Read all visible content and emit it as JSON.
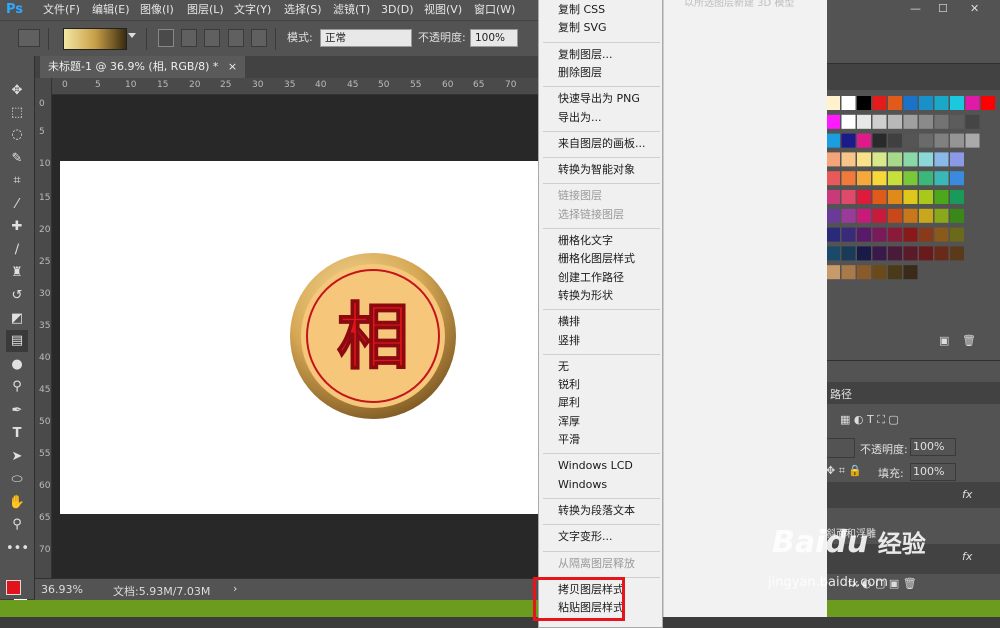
{
  "app": {
    "logo": "Ps"
  },
  "menubar": {
    "items": [
      "文件(F)",
      "编辑(E)",
      "图像(I)",
      "图层(L)",
      "文字(Y)",
      "选择(S)",
      "滤镜(T)",
      "3D(D)",
      "视图(V)",
      "窗口(W)"
    ]
  },
  "options": {
    "mode_label": "模式:",
    "mode_value": "正常",
    "opacity_label": "不透明度:",
    "opacity_value": "100%"
  },
  "document": {
    "tab_title": "未标题-1 @ 36.9% (相, RGB/8) *",
    "close": "×",
    "chess_char": "相"
  },
  "ruler": {
    "h_ticks": [
      "0",
      "5",
      "10",
      "15",
      "20",
      "25",
      "30",
      "35",
      "40",
      "45",
      "50",
      "55",
      "60",
      "65",
      "70"
    ],
    "v_ticks": [
      "0",
      "5",
      "10",
      "15",
      "20",
      "25",
      "30",
      "35",
      "40",
      "45",
      "50",
      "55",
      "60",
      "65",
      "70"
    ]
  },
  "status": {
    "zoom": "36.93%",
    "doc_size": "文档:5.93M/7.03M",
    "arrow": "›"
  },
  "context_menu": {
    "items": [
      {
        "label": "复制 CSS",
        "disabled": false
      },
      {
        "label": "复制 SVG",
        "disabled": false
      },
      {
        "sep": true
      },
      {
        "label": "复制图层...",
        "disabled": false
      },
      {
        "label": "删除图层",
        "disabled": false
      },
      {
        "sep": true
      },
      {
        "label": "快速导出为 PNG",
        "disabled": false
      },
      {
        "label": "导出为...",
        "disabled": false
      },
      {
        "sep": true
      },
      {
        "label": "来自图层的画板...",
        "disabled": false
      },
      {
        "sep": true
      },
      {
        "label": "转换为智能对象",
        "disabled": false
      },
      {
        "sep": true
      },
      {
        "label": "链接图层",
        "disabled": true
      },
      {
        "label": "选择链接图层",
        "disabled": true
      },
      {
        "sep": true
      },
      {
        "label": "栅格化文字",
        "disabled": false
      },
      {
        "label": "栅格化图层样式",
        "disabled": false
      },
      {
        "label": "创建工作路径",
        "disabled": false
      },
      {
        "label": "转换为形状",
        "disabled": false
      },
      {
        "sep": true
      },
      {
        "label": "横排",
        "disabled": false
      },
      {
        "label": "竖排",
        "disabled": false
      },
      {
        "sep": true
      },
      {
        "label": "无",
        "disabled": false
      },
      {
        "label": "锐利",
        "disabled": false
      },
      {
        "label": "犀利",
        "disabled": false
      },
      {
        "label": "浑厚",
        "disabled": false
      },
      {
        "label": "平滑",
        "disabled": false
      },
      {
        "sep": true
      },
      {
        "label": "Windows LCD",
        "disabled": false
      },
      {
        "label": "Windows",
        "disabled": false
      },
      {
        "sep": true
      },
      {
        "label": "转换为段落文本",
        "disabled": false
      },
      {
        "sep": true
      },
      {
        "label": "文字变形...",
        "disabled": false
      },
      {
        "sep": true
      },
      {
        "label": "从隔离图层释放",
        "disabled": true
      },
      {
        "sep": true
      },
      {
        "label": "拷贝图层样式",
        "disabled": false
      },
      {
        "label": "粘贴图层样式",
        "disabled": false
      }
    ]
  },
  "background_panel": {
    "text": "以所选图层新建 3D 模型"
  },
  "right_panel": {
    "paths_tab": "路径",
    "opacity_label": "不透明度:",
    "opacity_value": "100%",
    "fill_label": "填充:",
    "fill_value": "100%",
    "fx": "fx",
    "layer_sub": "斜面和浮雕"
  },
  "watermark": {
    "brand": "Baidu",
    "jingyan": "经验",
    "url": "jingyan.baidu.com"
  },
  "colors": {
    "foreground": "#e0141a",
    "background": "#ffffff",
    "highlight": "#e8141c",
    "accent_green": "#6b9c1e"
  }
}
